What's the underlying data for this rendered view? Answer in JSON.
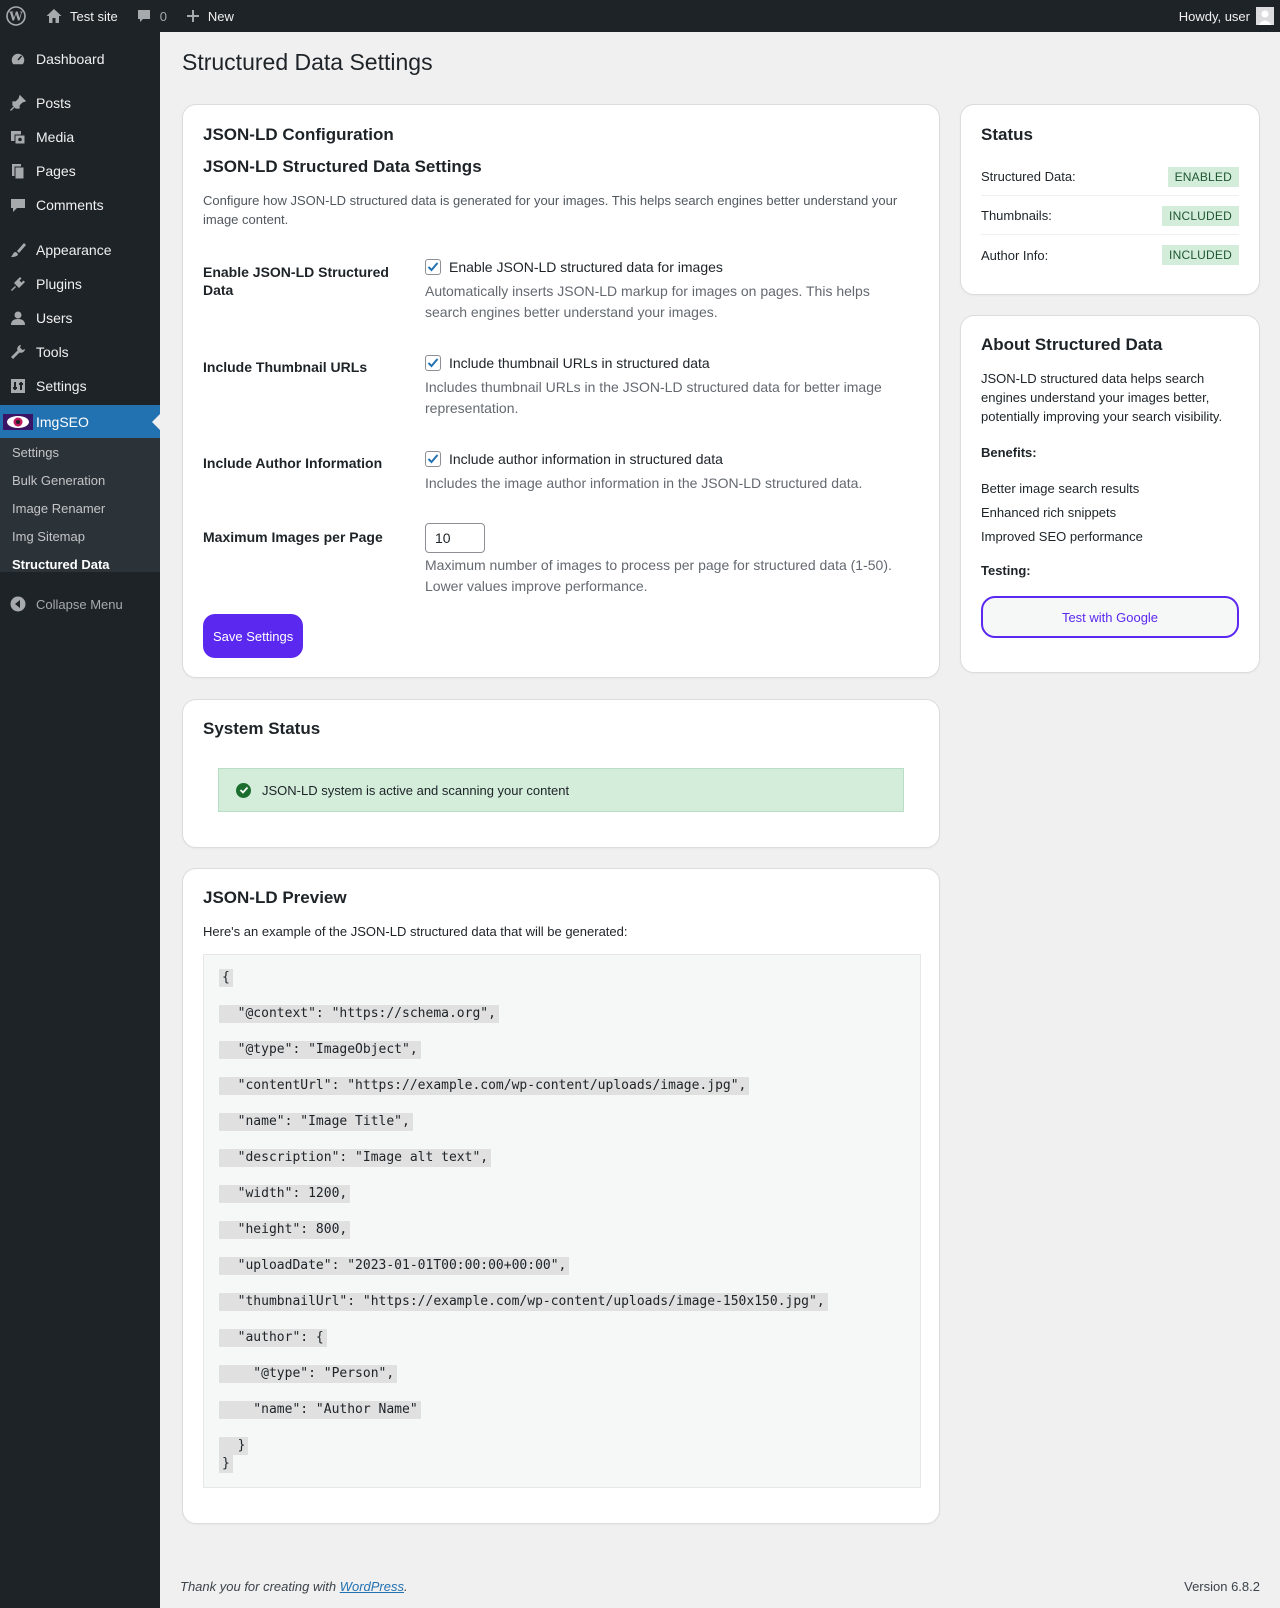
{
  "adminbar": {
    "site_name": "Test site",
    "comments_count": "0",
    "new_label": "New",
    "howdy": "Howdy, user"
  },
  "sidebar": {
    "items": [
      {
        "label": "Dashboard",
        "icon": "dashboard-icon"
      },
      {
        "label": "Posts",
        "icon": "pin-icon"
      },
      {
        "label": "Media",
        "icon": "media-icon"
      },
      {
        "label": "Pages",
        "icon": "pages-icon"
      },
      {
        "label": "Comments",
        "icon": "comment-icon"
      },
      {
        "label": "Appearance",
        "icon": "brush-icon"
      },
      {
        "label": "Plugins",
        "icon": "plug-icon"
      },
      {
        "label": "Users",
        "icon": "user-icon"
      },
      {
        "label": "Tools",
        "icon": "wrench-icon"
      },
      {
        "label": "Settings",
        "icon": "settings-icon"
      },
      {
        "label": "ImgSEO",
        "icon": "imgseo-eye-icon"
      }
    ],
    "submenu": [
      "Settings",
      "Bulk Generation",
      "Image Renamer",
      "Img Sitemap",
      "Structured Data"
    ],
    "collapse_label": "Collapse Menu"
  },
  "page_title": "Structured Data Settings",
  "config": {
    "title": "JSON-LD Configuration",
    "subtitle": "JSON-LD Structured Data Settings",
    "intro": "Configure how JSON-LD structured data is generated for your images. This helps search engines better understand your image content.",
    "fields": [
      {
        "label": "Enable JSON-LD Structured Data",
        "checkbox_label": "Enable JSON-LD structured data for images",
        "checked": true,
        "help": "Automatically inserts JSON-LD markup for images on pages. This helps search engines better understand your images."
      },
      {
        "label": "Include Thumbnail URLs",
        "checkbox_label": "Include thumbnail URLs in structured data",
        "checked": true,
        "help": "Includes thumbnail URLs in the JSON-LD structured data for better image representation."
      },
      {
        "label": "Include Author Information",
        "checkbox_label": "Include author information in structured data",
        "checked": true,
        "help": "Includes the image author information in the JSON-LD structured data."
      }
    ],
    "max_images": {
      "label": "Maximum Images per Page",
      "value": "10",
      "help": "Maximum number of images to process per page for structured data (1-50). Lower values improve performance."
    },
    "save_label": "Save Settings"
  },
  "system_status": {
    "title": "System Status",
    "message": "JSON-LD system is active and scanning your content"
  },
  "preview": {
    "title": "JSON-LD Preview",
    "intro": "Here's an example of the JSON-LD structured data that will be generated:",
    "lines": [
      "{",
      "  \"@context\": \"https://schema.org\",",
      "  \"@type\": \"ImageObject\",",
      "  \"contentUrl\": \"https://example.com/wp-content/uploads/image.jpg\",",
      "  \"name\": \"Image Title\",",
      "  \"description\": \"Image alt text\",",
      "  \"width\": 1200,",
      "  \"height\": 800,",
      "  \"uploadDate\": \"2023-01-01T00:00:00+00:00\",",
      "  \"thumbnailUrl\": \"https://example.com/wp-content/uploads/image-150x150.jpg\",",
      "  \"author\": {",
      "    \"@type\": \"Person\",",
      "    \"name\": \"Author Name\"",
      "  }",
      "}"
    ]
  },
  "status_card": {
    "title": "Status",
    "rows": [
      {
        "label": "Structured Data:",
        "badge": "ENABLED"
      },
      {
        "label": "Thumbnails:",
        "badge": "INCLUDED"
      },
      {
        "label": "Author Info:",
        "badge": "INCLUDED"
      }
    ]
  },
  "about": {
    "title": "About Structured Data",
    "text": "JSON-LD structured data helps search engines understand your images better, potentially improving your search visibility.",
    "benefits_label": "Benefits:",
    "benefits": [
      "Better image search results",
      "Enhanced rich snippets",
      "Improved SEO performance"
    ],
    "testing_label": "Testing:",
    "test_button": "Test with Google"
  },
  "footer": {
    "thanks_prefix": "Thank you for creating with ",
    "wordpress_link": "WordPress",
    "thanks_suffix": ".",
    "version": "Version 6.8.2"
  },
  "colors": {
    "admin_dark": "#1d2327",
    "active_blue": "#2271b1",
    "primary_purple": "#5b28f0",
    "success_bg": "#d4eddb"
  }
}
